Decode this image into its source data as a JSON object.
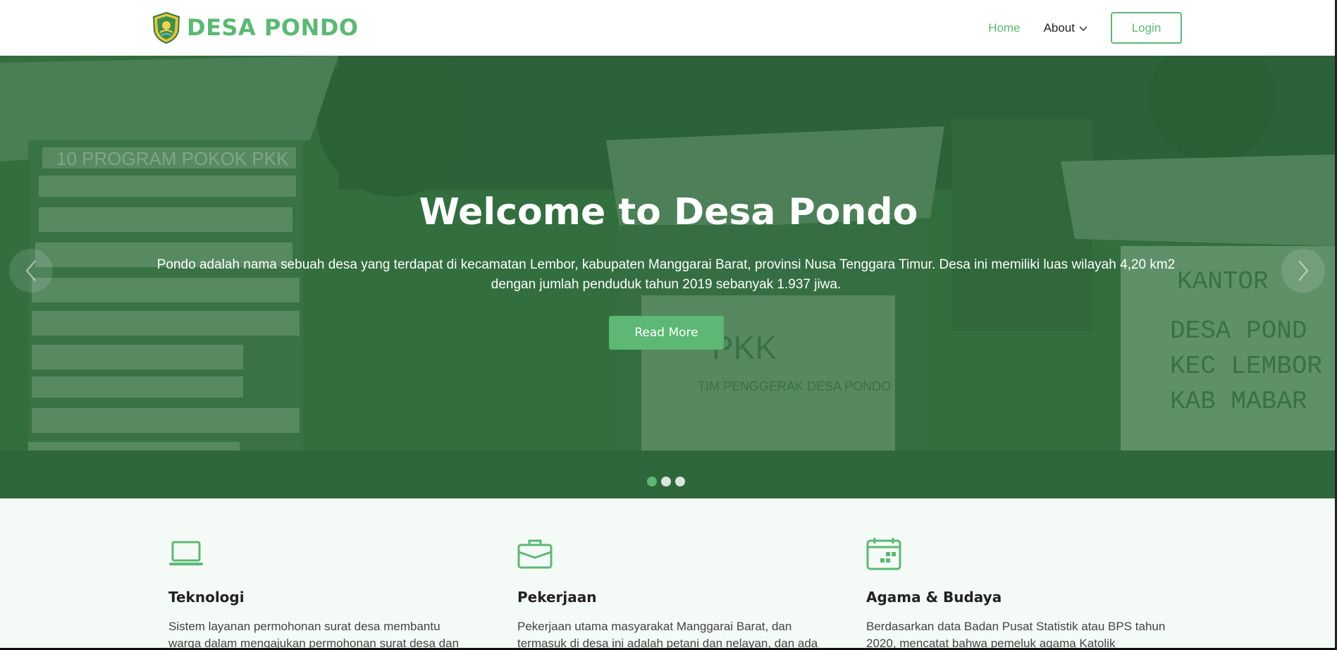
{
  "header": {
    "logo_text": "DESA PONDO",
    "nav": [
      {
        "label": "Home",
        "active": true
      },
      {
        "label": "About",
        "has_dropdown": true
      }
    ],
    "login_label": "Login"
  },
  "hero": {
    "title": "Welcome to Desa Pondo",
    "description": "Pondo adalah nama sebuah desa yang terdapat di kecamatan Lembor, kabupaten Manggarai Barat, provinsi Nusa Tenggara Timur. Desa ini memiliki luas wilayah 4,20 km2 dengan jumlah penduduk tahun 2019 sebanyak 1.937 jiwa.",
    "button_label": "Read More",
    "slides_total": 3,
    "active_slide": 1,
    "signs": {
      "pkk_left": "10 PROGRAM POKOK PKK",
      "pkk_center": "PKK",
      "pkk_center_sub": "TIM PENGGERAK DESA PONDO",
      "kantor_1": "KANTOR",
      "kantor_2": "DESA POND",
      "kantor_3": "KEC LEMBOR",
      "kantor_4": "KAB MABAR"
    }
  },
  "features": [
    {
      "icon": "laptop-icon",
      "title": "Teknologi",
      "text": "Sistem layanan permohonan surat desa membantu warga dalam mengajukan permohonan surat desa dan"
    },
    {
      "icon": "briefcase-icon",
      "title": "Pekerjaan",
      "text": "Pekerjaan utama masyarakat Manggarai Barat, dan termasuk di desa ini adalah petani dan nelayan, dan ada"
    },
    {
      "icon": "calendar-icon",
      "title": "Agama & Budaya",
      "text": "Berdasarkan data Badan Pusat Statistik atau BPS tahun 2020, mencatat bahwa pemeluk agama Katolik sebanyak"
    }
  ],
  "colors": {
    "accent": "#5cb874",
    "hero_overlay": "#2f6a40",
    "features_bg": "#f4faf6"
  }
}
